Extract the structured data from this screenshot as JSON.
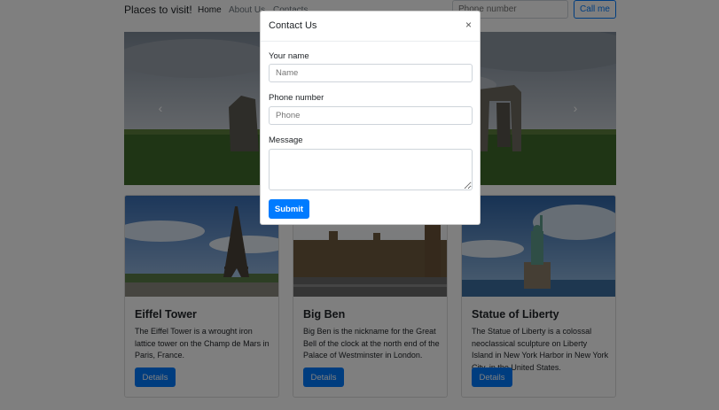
{
  "navbar": {
    "brand": "Places to visit!",
    "links": [
      "Home",
      "About Us",
      "Contacts"
    ],
    "phone_placeholder": "Phone number",
    "call_button": "Call me"
  },
  "carousel": {
    "prev_icon": "chevron-left-icon",
    "next_icon": "chevron-right-icon"
  },
  "cards": [
    {
      "title": "Eiffel Tower",
      "text": "The Eiffel Tower is a wrought iron lattice tower on the Champ de Mars in Paris, France.",
      "button": "Details"
    },
    {
      "title": "Big Ben",
      "text": "Big Ben is the nickname for the Great Bell of the clock at the north end of the Palace of Westminster in London.",
      "button": "Details"
    },
    {
      "title": "Statue of Liberty",
      "text": "The Statue of Liberty is a colossal neoclassical sculpture on Liberty Island in New York Harbor in New York City, in the United States.",
      "button": "Details"
    }
  ],
  "modal": {
    "title": "Contact Us",
    "close": "×",
    "name_label": "Your name",
    "name_placeholder": "Name",
    "phone_label": "Phone number",
    "phone_placeholder": "Phone",
    "message_label": "Message",
    "submit": "Submit"
  },
  "colors": {
    "primary": "#007bff",
    "backdrop": "rgba(0,0,0,0.5)"
  }
}
